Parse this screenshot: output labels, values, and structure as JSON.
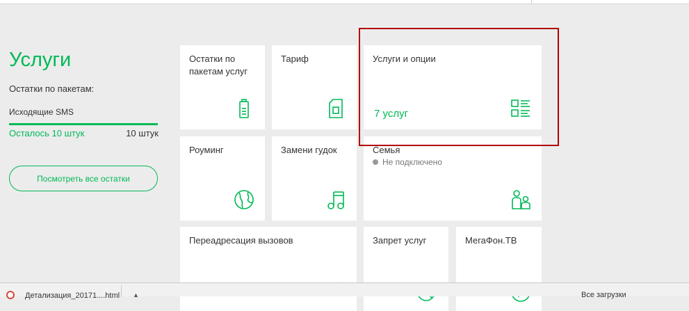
{
  "sidebar": {
    "title": "Услуги",
    "subtitle": "Остатки по пакетам:",
    "package": {
      "name": "Исходящие SMS",
      "remaining": "Осталось 10 штук",
      "total": "10 штук",
      "fill_fraction": 1.0
    },
    "view_all_label": "Посмотреть все остатки"
  },
  "tiles": {
    "balances": {
      "label": "Остатки по пакетам услуг",
      "icon": "battery-icon"
    },
    "tariff": {
      "label": "Тариф",
      "icon": "sim-card-icon"
    },
    "services": {
      "label": "Услуги и опции",
      "value": "7 услуг",
      "icon": "list-icon"
    },
    "roaming": {
      "label": "Роуминг",
      "icon": "globe-icon"
    },
    "ringback": {
      "label": "Замени гудок",
      "icon": "music-note-icon"
    },
    "family": {
      "label": "Семья",
      "status": "Не подключено",
      "icon": "family-icon"
    },
    "forwarding": {
      "label": "Переадресация вызовов",
      "icon": "call-forward-icon"
    },
    "restriction": {
      "label": "Запрет услуг",
      "icon": "block-icon"
    },
    "tv": {
      "label": "МегаФон.ТВ",
      "icon": "tv-icon"
    }
  },
  "colors": {
    "brand_green": "#00b956",
    "highlight_red": "#b30000",
    "background": "#ececec"
  },
  "download_bar": {
    "file_name": "Детализация_20171....html",
    "show_all_label": "Все загрузки"
  }
}
